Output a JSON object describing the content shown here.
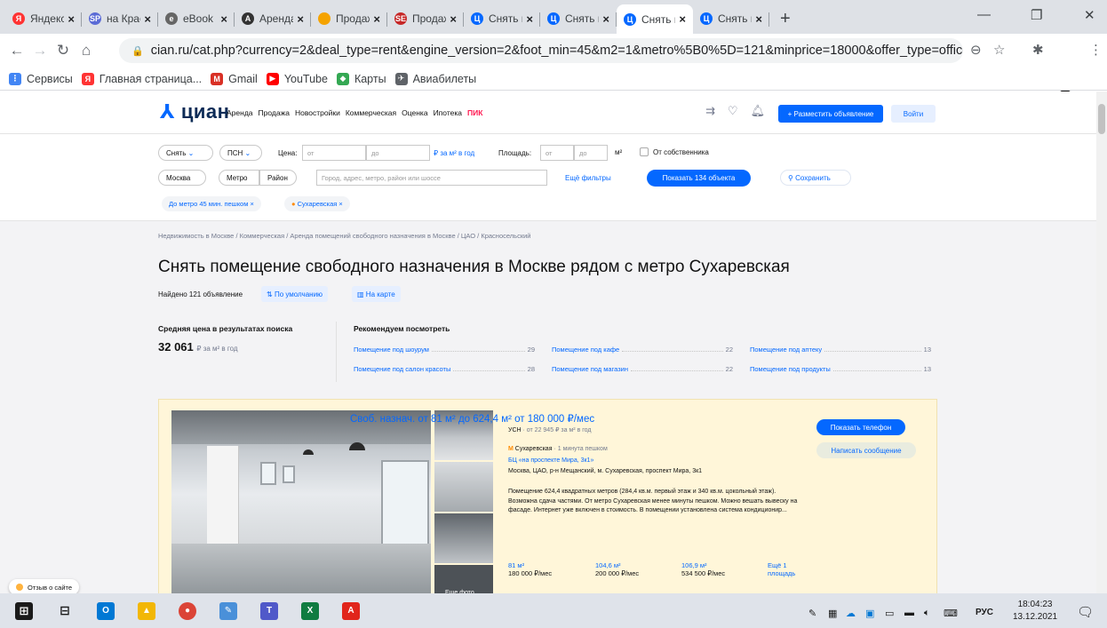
{
  "browser": {
    "tabs": [
      {
        "label": "Яндекс",
        "color": "#f33",
        "glyph": "Я",
        "active": false
      },
      {
        "label": "на Крас",
        "color": "#5b6bd6",
        "glyph": "SP",
        "active": false
      },
      {
        "label": "eBook",
        "color": "#666",
        "glyph": "e",
        "active": false
      },
      {
        "label": "Аренда",
        "color": "#333",
        "glyph": "A",
        "active": false
      },
      {
        "label": "Продаж",
        "color": "#f5a300",
        "glyph": "",
        "active": false
      },
      {
        "label": "Продаж",
        "color": "#c62828",
        "glyph": "SE",
        "active": false
      },
      {
        "label": "Снять п",
        "color": "#0468ff",
        "glyph": "Ц",
        "active": false
      },
      {
        "label": "Снять п",
        "color": "#0468ff",
        "glyph": "Ц",
        "active": false
      },
      {
        "label": "Снять п",
        "color": "#0468ff",
        "glyph": "Ц",
        "active": true
      },
      {
        "label": "Снять п",
        "color": "#0468ff",
        "glyph": "Ц",
        "active": false
      }
    ],
    "new_tab": "+",
    "url": "cian.ru/cat.php?currency=2&deal_type=rent&engine_version=2&foot_min=45&m2=1&metro%5B0%5D=121&minprice=18000&offer_type=offices...",
    "bookmarks": [
      {
        "label": "Сервисы",
        "color": "#4285f4",
        "glyph": "⋮"
      },
      {
        "label": "Главная страница...",
        "color": "#f33",
        "glyph": "Я"
      },
      {
        "label": "Gmail",
        "color": "#d93025",
        "glyph": "M"
      },
      {
        "label": "YouTube",
        "color": "#ff0000",
        "glyph": "▶"
      },
      {
        "label": "Карты",
        "color": "#34a853",
        "glyph": "◆"
      },
      {
        "label": "Авиабилеты",
        "color": "#5f6368",
        "glyph": "✈"
      }
    ]
  },
  "site": {
    "logo": "циан",
    "nav": [
      "Аренда",
      "Продажа",
      "Новостройки",
      "Коммерческая",
      "Оценка",
      "Ипотека"
    ],
    "nav_pik": "ПИК",
    "post_button": "+ Разместить объявление",
    "login_button": "Войти"
  },
  "filters": {
    "deal": "Снять",
    "type": "ПСН",
    "price_label": "Цена:",
    "price_from": "от",
    "price_to": "до",
    "price_unit": "₽ за м² в год",
    "area_label": "Площадь:",
    "area_from": "от",
    "area_to": "до",
    "area_unit": "м²",
    "owner_label": "От собственника",
    "city": "Москва",
    "metro": "Метро",
    "district": "Район",
    "search_placeholder": "Город, адрес, метро, район или шоссе",
    "more_filters": "Ещё фильтры",
    "show_button": "Показать 134 объекта",
    "save_button": "Сохранить",
    "chips": [
      "До метро 45 мин. пешком ×",
      "Сухаревская ×"
    ]
  },
  "results": {
    "breadcrumbs": "Недвижимость в Москве / Коммерческая / Аренда помещений свободного назначения в Москве / ЦАО / Красносельский",
    "title": "Снять помещение свободного назначения в Москве рядом с метро Сухаревская",
    "found": "Найдено 121 объявление",
    "sort_label": "По умолчанию",
    "map_label": "На карте",
    "avg_title": "Средняя цена в результатах поиска",
    "avg_value": "32 061",
    "avg_unit": "₽ за м² в год",
    "recommend_title": "Рекомендуем посмотреть",
    "recommend": [
      {
        "label": "Помещение под шоурум",
        "count": "29"
      },
      {
        "label": "Помещение под кафе",
        "count": "22"
      },
      {
        "label": "Помещение под аптеку",
        "count": "13"
      },
      {
        "label": "Помещение под салон красоты",
        "count": "28"
      },
      {
        "label": "Помещение под магазин",
        "count": "22"
      },
      {
        "label": "Помещение под продукты",
        "count": "13"
      }
    ]
  },
  "card": {
    "title": "Своб. назнач. от 81 м² до 624,4 м² от 180 000 ₽/мес",
    "tax": "УСН",
    "tax_price": "· от 22 945 ₽ за м² в год",
    "metro": "Сухаревская",
    "metro_time": "· 1 минута пешком",
    "bc": "БЦ «на проспекте Мира, 3к1»",
    "address": "Москва, ЦАО, р-н Мещанский, м. Сухаревская, проспект Мира, 3к1",
    "description": "Помещение 624,4 квадратных метров (284,4 кв.м. первый этаж и 340 кв.м. цокольный этаж). Возможна сдача частями. От метро Сухаревская менее минуты пешком. Можно вешать вывеску на фасаде. Интернет уже включен в стоимость. В помещении установлена система кондиционир...",
    "show_phone": "Показать телефон",
    "write_message": "Написать сообщение",
    "more_photo": "Еще фото",
    "areas": [
      {
        "area": "81 м²",
        "price": "180 000 ₽/мес"
      },
      {
        "area": "104,6 м²",
        "price": "200 000 ₽/мес"
      },
      {
        "area": "106,9 м²",
        "price": "534 500 ₽/мес"
      },
      {
        "area": "Ещё 1",
        "price": "площадь"
      }
    ]
  },
  "feedback": "Отзыв о сайте",
  "taskbar": {
    "lang": "РУС",
    "time": "18:04:23",
    "date": "13.12.2021"
  }
}
